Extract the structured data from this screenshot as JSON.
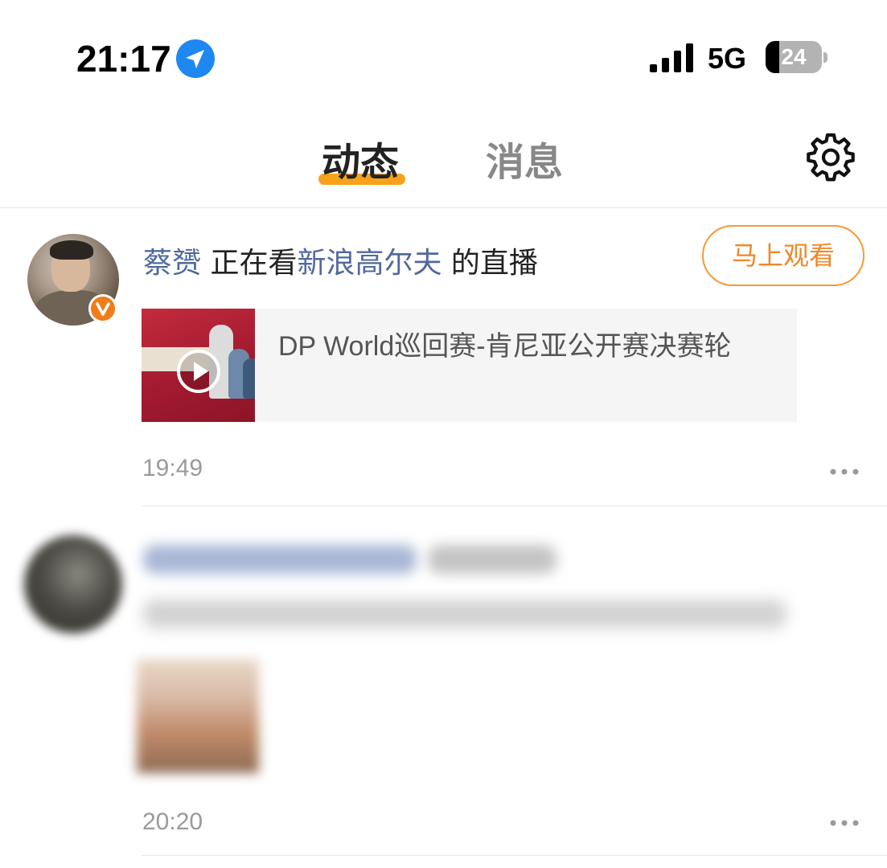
{
  "status_bar": {
    "time": "21:17",
    "network": "5G",
    "battery_level": "24",
    "battery_percent": 24
  },
  "tabs": [
    {
      "label": "动态",
      "active": true
    },
    {
      "label": "消息",
      "active": false
    }
  ],
  "feed": [
    {
      "user": "蔡赟",
      "action": " 正在看",
      "channel": "新浪高尔夫",
      "suffix": " 的直播",
      "button_label": "马上观看",
      "live_title": "DP World巡回赛-肯尼亚公开赛决赛轮",
      "timestamp": "19:49"
    },
    {
      "timestamp": "20:20"
    }
  ],
  "colors": {
    "accent_orange": "#f7a21b",
    "button_orange": "#f39a36",
    "link_blue": "#50689d",
    "location_blue": "#1e88f0",
    "verified_orange": "#f07c1a"
  },
  "icons": {
    "location": "location-arrow-icon",
    "signal": "cellular-signal-icon",
    "settings": "gear-icon",
    "play": "play-icon",
    "more": "more-dots-icon",
    "verified": "verified-v-icon"
  }
}
